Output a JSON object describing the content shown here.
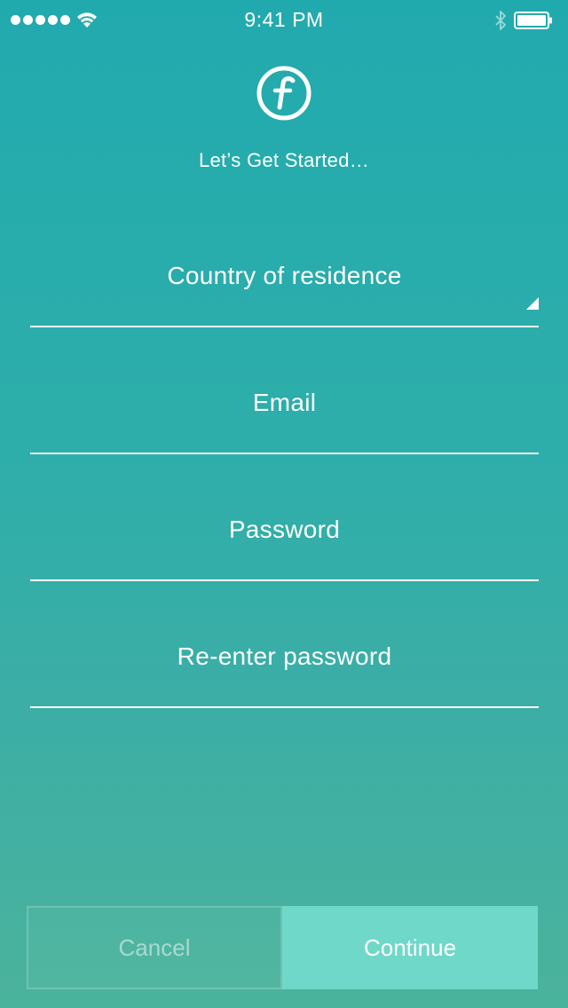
{
  "status_bar": {
    "time": "9:41 PM"
  },
  "header": {
    "logo_letter": "f",
    "title": "Let’s Get Started…"
  },
  "form": {
    "country_placeholder": "Country of residence",
    "email_placeholder": "Email",
    "password_placeholder": "Password",
    "reenter_password_placeholder": "Re-enter password"
  },
  "actions": {
    "cancel_label": "Cancel",
    "continue_label": "Continue"
  },
  "colors": {
    "background_top": "#21aaae",
    "background_bottom": "#4bb39c",
    "continue_button": "#70d8c8",
    "text": "#ffffff"
  },
  "icons": [
    "signal-dots-icon",
    "wifi-icon",
    "bluetooth-icon",
    "battery-icon",
    "app-logo-icon",
    "dropdown-arrow-icon"
  ]
}
